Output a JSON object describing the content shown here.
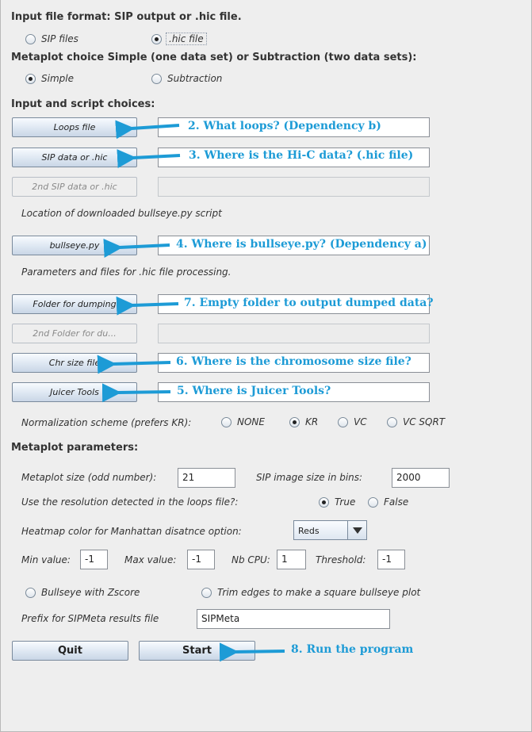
{
  "sections": {
    "input_format": "Input file format: SIP output or .hic file.",
    "metaplot_choice": "Metaplot choice Simple (one data set) or Subtraction (two data sets):",
    "input_script": "Input and script choices:",
    "metaplot_params": "Metaplot parameters:"
  },
  "format_options": {
    "sip": "SIP files",
    "hic": ".hic file",
    "selected": "hic"
  },
  "mode_options": {
    "simple": "Simple",
    "subtraction": "Subtraction",
    "selected": "simple"
  },
  "buttons": {
    "loops": "Loops file",
    "sip_data": "SIP data or .hic",
    "sip_data2": "2nd SIP data or .hic",
    "bullseye": "bullseye.py",
    "dump_folder": "Folder for dumping",
    "dump_folder2": "2nd Folder for du...",
    "chr_size": "Chr size file",
    "juicer": "Juicer Tools",
    "quit": "Quit",
    "start": "Start"
  },
  "labels": {
    "bullseye_location": "Location of downloaded bullseye.py script",
    "hic_params": "Parameters and files for .hic file processing.",
    "normalization": "Normalization scheme (prefers KR):",
    "metaplot_size": "Metaplot size (odd number):",
    "sip_image_size": "SIP image size in bins:",
    "use_resolution": "Use the resolution detected in the loops file?:",
    "heatmap_color": "Heatmap color for Manhattan disatnce option:",
    "min_value": "Min value:",
    "max_value": "Max value:",
    "nb_cpu": "Nb CPU:",
    "threshold": "Threshold:",
    "bullseye_zscore": "Bullseye with Zscore",
    "trim_edges": "Trim edges to make a square bullseye plot",
    "prefix": "Prefix for SIPMeta results file"
  },
  "normalization_options": {
    "none": "NONE",
    "kr": "KR",
    "vc": "VC",
    "vc_sqrt": "VC SQRT",
    "selected": "kr"
  },
  "resolution_options": {
    "true": "True",
    "false": "False",
    "selected": "true"
  },
  "values": {
    "metaplot_size": "21",
    "sip_image_size": "2000",
    "heatmap_color": "Reds",
    "min_value": "-1",
    "max_value": "-1",
    "nb_cpu": "1",
    "threshold": "-1",
    "prefix": "SIPMeta"
  },
  "annotations": {
    "loops": "2.   What loops? (Dependency b)",
    "sip_data": "3.   Where is the Hi-C data? (.hic file)",
    "bullseye": "4.   Where is bullseye.py? (Dependency a)",
    "dump_folder": "7.   Empty folder to output dumped data?",
    "chr_size": "6.   Where is the chromosome size file?",
    "juicer": "5.   Where is Juicer Tools?",
    "start": "8.   Run the program"
  },
  "colors": {
    "annotation": "#1d9bd6",
    "background": "#eeeeee"
  }
}
